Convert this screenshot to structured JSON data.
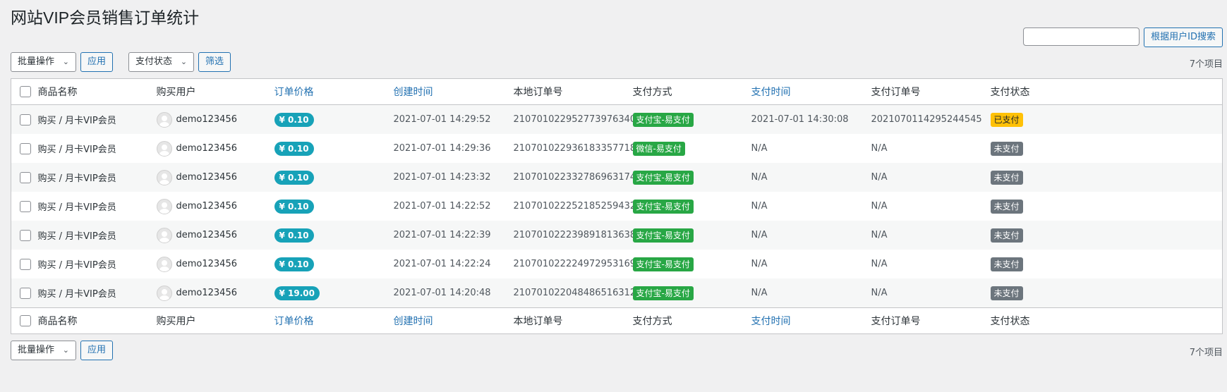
{
  "page": {
    "title": "网站VIP会员销售订单统计"
  },
  "search": {
    "placeholder": "",
    "button_label": "根据用户ID搜索"
  },
  "top_nav": {
    "bulk_action": "批量操作",
    "apply_label": "应用",
    "filter_select": "支付状态",
    "filter_label": "筛选",
    "count": "7个项目"
  },
  "bottom_nav": {
    "bulk_action": "批量操作",
    "apply_label": "应用",
    "count": "7个项目"
  },
  "columns": {
    "product": "商品名称",
    "user": "购买用户",
    "price": "订单价格",
    "created": "创建时间",
    "order_no": "本地订单号",
    "pay_method": "支付方式",
    "pay_time": "支付时间",
    "pay_order_no": "支付订单号",
    "pay_status": "支付状态"
  },
  "colors": {
    "price_badge": "#17a2b8",
    "pay_badge": "#28a745",
    "paid_badge": "#ffc107",
    "unpaid_badge": "#6c757d",
    "link": "#2271b1"
  },
  "rows": [
    {
      "product": "购买 / 月卡VIP会员",
      "user": "demo123456",
      "price": "¥ 0.10",
      "created": "2021-07-01 14:29:52",
      "order_no": "210701022952773976340",
      "pay_method": "支付宝-易支付",
      "pay_time": "2021-07-01 14:30:08",
      "pay_order_no": "2021070114295244545",
      "status": "已支付",
      "status_type": "paid"
    },
    {
      "product": "购买 / 月卡VIP会员",
      "user": "demo123456",
      "price": "¥ 0.10",
      "created": "2021-07-01 14:29:36",
      "order_no": "210701022936183357718",
      "pay_method": "微信-易支付",
      "pay_time": "N/A",
      "pay_order_no": "N/A",
      "status": "未支付",
      "status_type": "unpaid"
    },
    {
      "product": "购买 / 月卡VIP会员",
      "user": "demo123456",
      "price": "¥ 0.10",
      "created": "2021-07-01 14:23:32",
      "order_no": "210701022332786963174",
      "pay_method": "支付宝-易支付",
      "pay_time": "N/A",
      "pay_order_no": "N/A",
      "status": "未支付",
      "status_type": "unpaid"
    },
    {
      "product": "购买 / 月卡VIP会员",
      "user": "demo123456",
      "price": "¥ 0.10",
      "created": "2021-07-01 14:22:52",
      "order_no": "210701022252185259432",
      "pay_method": "支付宝-易支付",
      "pay_time": "N/A",
      "pay_order_no": "N/A",
      "status": "未支付",
      "status_type": "unpaid"
    },
    {
      "product": "购买 / 月卡VIP会员",
      "user": "demo123456",
      "price": "¥ 0.10",
      "created": "2021-07-01 14:22:39",
      "order_no": "210701022239891813638",
      "pay_method": "支付宝-易支付",
      "pay_time": "N/A",
      "pay_order_no": "N/A",
      "status": "未支付",
      "status_type": "unpaid"
    },
    {
      "product": "购买 / 月卡VIP会员",
      "user": "demo123456",
      "price": "¥ 0.10",
      "created": "2021-07-01 14:22:24",
      "order_no": "210701022224972953169",
      "pay_method": "支付宝-易支付",
      "pay_time": "N/A",
      "pay_order_no": "N/A",
      "status": "未支付",
      "status_type": "unpaid"
    },
    {
      "product": "购买 / 月卡VIP会员",
      "user": "demo123456",
      "price": "¥ 19.00",
      "created": "2021-07-01 14:20:48",
      "order_no": "210701022048486516312",
      "pay_method": "支付宝-易支付",
      "pay_time": "N/A",
      "pay_order_no": "N/A",
      "status": "未支付",
      "status_type": "unpaid"
    }
  ]
}
